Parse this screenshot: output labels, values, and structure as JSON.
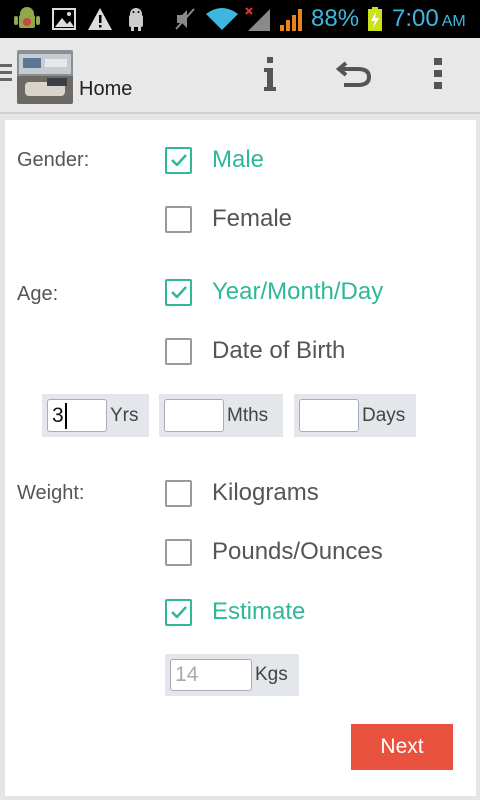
{
  "status_bar": {
    "icons": [
      "android-debug-icon",
      "image-icon",
      "warning-icon",
      "android-icon",
      "mute-icon",
      "wifi-icon",
      "signal-no-service-icon",
      "signal-icon",
      "battery-charging-icon"
    ],
    "battery_percent": "88%",
    "time": "7:00",
    "ampm": "AM"
  },
  "action_bar": {
    "title": "Home",
    "buttons": [
      "info-icon",
      "undo-icon",
      "overflow-menu-icon"
    ]
  },
  "form": {
    "gender": {
      "label": "Gender:",
      "options": [
        {
          "label": "Male",
          "checked": true
        },
        {
          "label": "Female",
          "checked": false
        }
      ]
    },
    "age": {
      "label": "Age:",
      "options": [
        {
          "label": "Year/Month/Day",
          "checked": true
        },
        {
          "label": "Date of Birth",
          "checked": false
        }
      ],
      "years": {
        "value": "3",
        "unit": "Yrs"
      },
      "months": {
        "value": "",
        "unit": "Mths"
      },
      "days": {
        "value": "",
        "unit": "Days"
      }
    },
    "weight": {
      "label": "Weight:",
      "options": [
        {
          "label": "Kilograms",
          "checked": false
        },
        {
          "label": "Pounds/Ounces",
          "checked": false
        },
        {
          "label": "Estimate",
          "checked": true
        }
      ],
      "estimate": {
        "value": "14",
        "unit": "Kgs"
      }
    }
  },
  "next_label": "Next",
  "colors": {
    "accent": "#2fb79a",
    "button": "#e9523e",
    "status_text": "#3eb7e0"
  }
}
